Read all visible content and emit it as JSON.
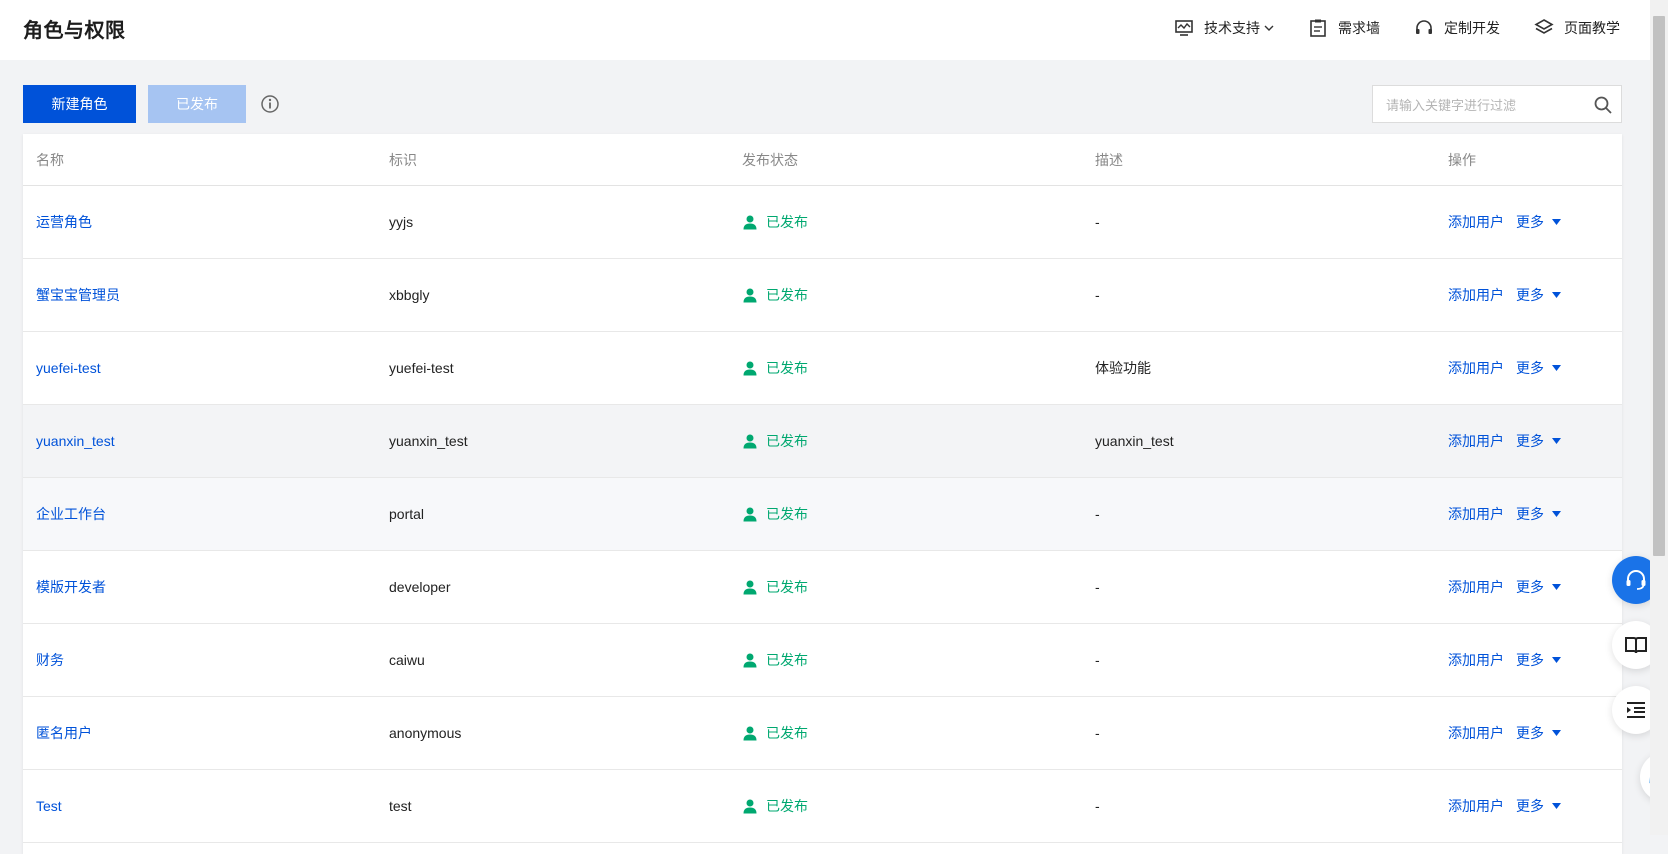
{
  "header": {
    "title": "角色与权限",
    "nav": [
      {
        "label": "技术支持",
        "icon": "monitor-chart-icon",
        "dropdown": true
      },
      {
        "label": "需求墙",
        "icon": "clipboard-icon"
      },
      {
        "label": "定制开发",
        "icon": "headset-icon"
      },
      {
        "label": "页面教学",
        "icon": "layers-icon"
      }
    ]
  },
  "toolbar": {
    "new_role": "新建角色",
    "published": "已发布",
    "search_placeholder": "请输入关键字进行过滤"
  },
  "table": {
    "columns": [
      "名称",
      "标识",
      "发布状态",
      "描述",
      "操作"
    ],
    "action_add": "添加用户",
    "action_more": "更多",
    "rows": [
      {
        "name": "运营角色",
        "id": "yyjs",
        "status": "已发布",
        "desc": "-"
      },
      {
        "name": "蟹宝宝管理员",
        "id": "xbbgly",
        "status": "已发布",
        "desc": "-"
      },
      {
        "name": "yuefei-test",
        "id": "yuefei-test",
        "status": "已发布",
        "desc": "体验功能"
      },
      {
        "name": "yuanxin_test",
        "id": "yuanxin_test",
        "status": "已发布",
        "desc": "yuanxin_test"
      },
      {
        "name": "企业工作台",
        "id": "portal",
        "status": "已发布",
        "desc": "-"
      },
      {
        "name": "模版开发者",
        "id": "developer",
        "status": "已发布",
        "desc": "-"
      },
      {
        "name": "财务",
        "id": "caiwu",
        "status": "已发布",
        "desc": "-"
      },
      {
        "name": "匿名用户",
        "id": "anonymous",
        "status": "已发布",
        "desc": "-"
      },
      {
        "name": "Test",
        "id": "test",
        "status": "已发布",
        "desc": "-"
      }
    ]
  },
  "colors": {
    "primary": "#0052d9",
    "disabled": "#a6c4f2",
    "success": "#00a870",
    "service": "#1a73e8"
  }
}
